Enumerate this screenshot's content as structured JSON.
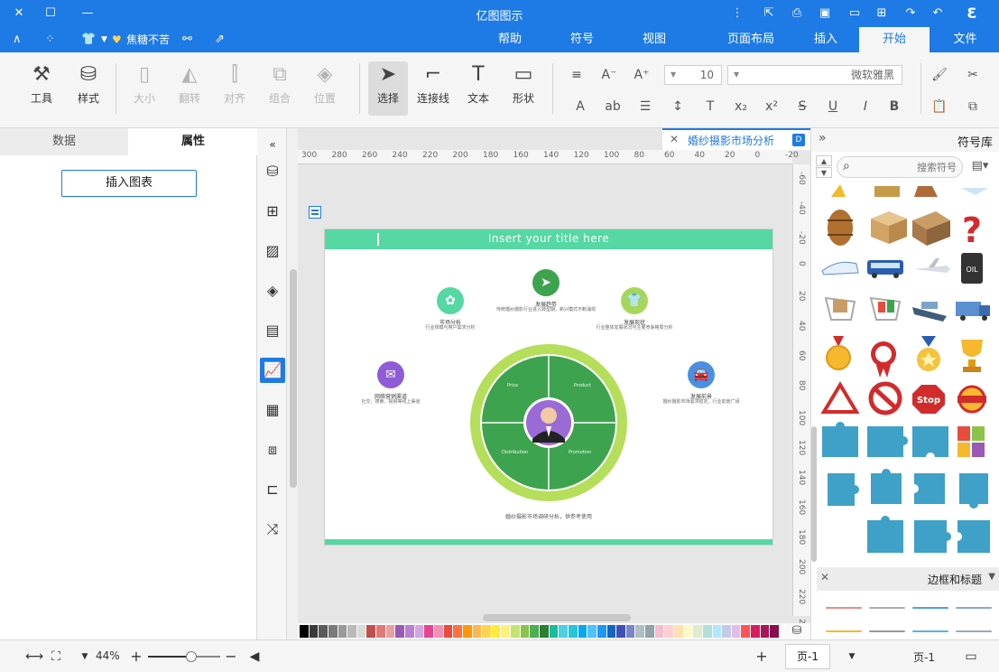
{
  "titlebar": {
    "title": "亿图图示",
    "icons": [
      "app-logo",
      "undo",
      "redo",
      "add-file",
      "open-folder",
      "save",
      "print",
      "export",
      "more",
      "minimize",
      "maximize",
      "close"
    ]
  },
  "menubar": {
    "tabs": [
      "文件",
      "开始",
      "插入",
      "页面布局",
      "视图",
      "符号",
      "帮助"
    ],
    "active_tab": "开始",
    "user_name": "焦糖不苦",
    "vip_badge": "♥"
  },
  "ribbon": {
    "tools": {
      "cut": "剪切",
      "font_name": "微软雅黑",
      "font_size": "10",
      "shape_label": "形状",
      "text_label": "文本",
      "connector_label": "连接线",
      "select_label": "选择",
      "position_label": "位置",
      "group_label": "组合",
      "align_label": "对齐",
      "flip_label": "翻转",
      "size_label": "大小",
      "style_label": "样式",
      "tools_label": "工具"
    }
  },
  "left_panel": {
    "tabs": [
      "属性",
      "数据"
    ],
    "active_tab": "属性",
    "insert_chart_button": "插入图表"
  },
  "document": {
    "tab_title": "婚纱摄影市场分析",
    "page_title": "Insert your title here",
    "nodes": [
      {
        "title": "发展趋势",
        "desc": "传统婚纱摄影行业进入转型期，新兴模式不断涌现"
      },
      {
        "title": "市场分析",
        "desc": "行业规模与用户需求分析"
      },
      {
        "title": "发展现状",
        "desc": "行业整体发展状况与主要竞争格局分析"
      },
      {
        "title": "发展前景",
        "desc": "婚纱摄影市场需求稳定，行业前景广阔"
      },
      {
        "title": "网络营销渠道",
        "desc": "社交、搜索、视频等线上渠道"
      }
    ],
    "quadrants": [
      "Product",
      "Price",
      "Promotion",
      "Distribution"
    ],
    "footer_note": "婚纱摄影市场调研分析，供参考使用"
  },
  "ruler": {
    "h_labels": [
      "300",
      "280",
      "260",
      "240",
      "220",
      "200",
      "180",
      "160",
      "140",
      "120",
      "100",
      "80",
      "60",
      "40",
      "20",
      "0",
      "-20"
    ],
    "v_labels": [
      "-60",
      "-40",
      "-20",
      "0",
      "20",
      "40",
      "60",
      "80",
      "100",
      "120",
      "140",
      "160",
      "180",
      "200",
      "220",
      "240"
    ]
  },
  "palette_colors": [
    "#000000",
    "#3a3a3a",
    "#5a5a5a",
    "#7a7a7a",
    "#9a9a9a",
    "#bababa",
    "#dadada",
    "#c0504d",
    "#e07a7a",
    "#e8a0a0",
    "#9b59b6",
    "#b980d0",
    "#d4a5e0",
    "#e84393",
    "#f48fb1",
    "#e74c3c",
    "#ff7043",
    "#ff9800",
    "#ffb74d",
    "#ffd54f",
    "#ffeb3b",
    "#fff176",
    "#c6e36b",
    "#8bc34a",
    "#4caf50",
    "#2e7d32",
    "#1abc9c",
    "#4dd0e1",
    "#26c6da",
    "#03a9f4",
    "#4fc3f7",
    "#2196f3",
    "#1565c0",
    "#3f51b5",
    "#7986cb",
    "#b0bec5",
    "#90a4ae",
    "#f8bbd0",
    "#ffcdd2",
    "#ffe0b2",
    "#fff9c4",
    "#dcedc8",
    "#b2dfdb",
    "#b3e5fc",
    "#c5cae9",
    "#e1bee7",
    "#ff5252",
    "#d81b60",
    "#ad1457",
    "#880e4f"
  ],
  "symbol_library": {
    "title": "符号库",
    "search_placeholder": "搜索符号",
    "section_title": "边框和标题"
  },
  "statusbar": {
    "page_label": "页-1",
    "page_tab": "页-1",
    "zoom": "44%",
    "zoom_fraction": 0.6
  },
  "colors": {
    "brand": "#1e7ae5",
    "accent_green": "#55d8a3",
    "wheel_outer": "#b5de5a",
    "wheel_inner": "#3ea34f"
  }
}
